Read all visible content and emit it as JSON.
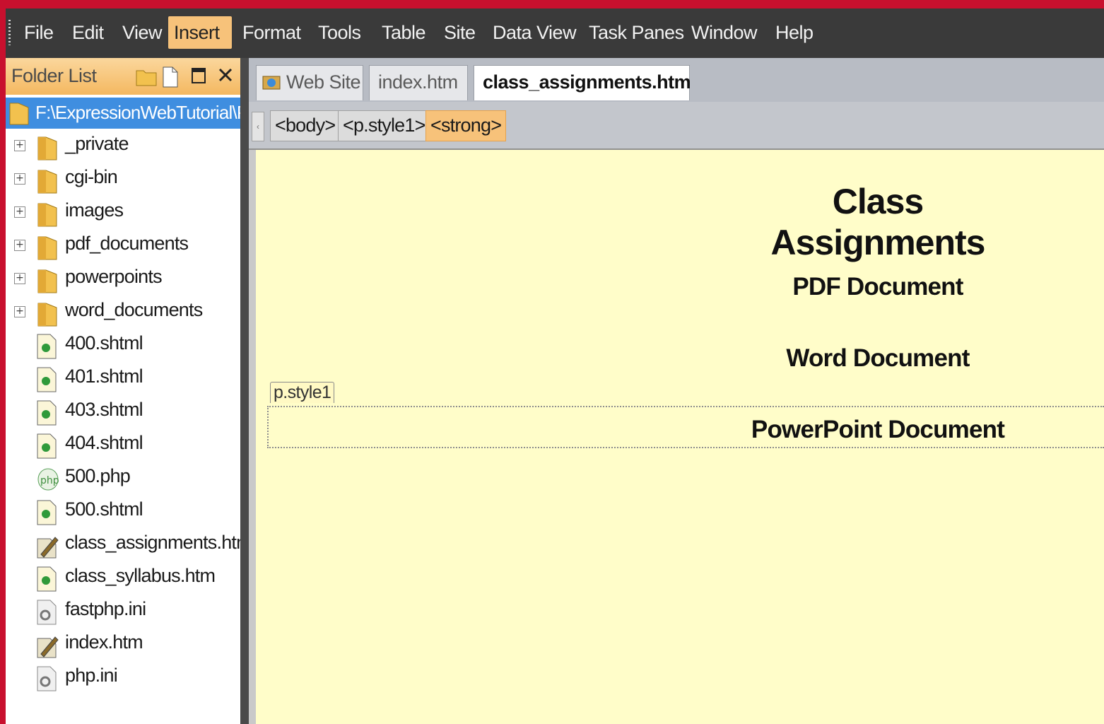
{
  "menu": [
    "File",
    "Edit",
    "View",
    "Insert",
    "Format",
    "Tools",
    "Table",
    "Site",
    "Data View",
    "Task Panes",
    "Window",
    "Help"
  ],
  "menu_active": "Insert",
  "folder_panel": {
    "title": "Folder List",
    "root": "F:\\ExpressionWebTutorial\\PowerPoints",
    "folders": [
      "_private",
      "cgi-bin",
      "images",
      "pdf_documents",
      "powerpoints",
      "word_documents"
    ],
    "files": [
      {
        "name": "400.shtml",
        "icon": "html-file-icon"
      },
      {
        "name": "401.shtml",
        "icon": "html-file-icon"
      },
      {
        "name": "403.shtml",
        "icon": "html-file-icon"
      },
      {
        "name": "404.shtml",
        "icon": "html-file-icon"
      },
      {
        "name": "500.php",
        "icon": "php-file-icon"
      },
      {
        "name": "500.shtml",
        "icon": "html-file-icon"
      },
      {
        "name": "class_assignments.htm",
        "icon": "edited-file-icon"
      },
      {
        "name": "class_syllabus.htm",
        "icon": "html-file-icon"
      },
      {
        "name": "fastphp.ini",
        "icon": "ini-file-icon"
      },
      {
        "name": "index.htm",
        "icon": "edited-file-icon"
      },
      {
        "name": "php.ini",
        "icon": "ini-file-icon"
      }
    ]
  },
  "tabs": [
    {
      "label": "Web Site",
      "active": false
    },
    {
      "label": "index.htm",
      "active": false
    },
    {
      "label": "class_assignments.htm",
      "active": true
    }
  ],
  "breadcrumbs": [
    "<body>",
    "<p.style1>",
    "<strong>"
  ],
  "document": {
    "title": "Class Assignments",
    "lines": [
      "PDF Document",
      "Word Document",
      "PowerPoint Document"
    ],
    "style_tag": "p.style1"
  },
  "colors": {
    "accent": "#f7c27a",
    "canvas_bg": "#fffdc9",
    "selection": "#3f8ee0",
    "frame": "#c8102e"
  }
}
